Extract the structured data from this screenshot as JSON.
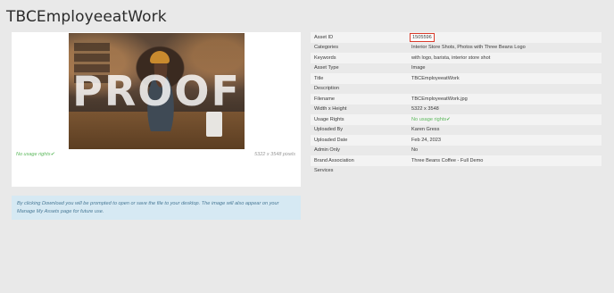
{
  "page": {
    "title": "TBCEmployeeatWork"
  },
  "preview": {
    "watermark": "PROOF",
    "usage_rights": "No usage rights✔",
    "dimensions": "5322 x 3548 pixels"
  },
  "notice": {
    "text": "By clicking Download you will be prompted to open or save the file to your desktop. The image will also appear on your Manage My Assets page for future use."
  },
  "details": [
    {
      "key": "Asset ID",
      "value": "1505596"
    },
    {
      "key": "Categories",
      "value": "Interior Store Shots, Photos with Three Beans Logo"
    },
    {
      "key": "Keywords",
      "value": "with logo, barista, interior store shot"
    },
    {
      "key": "Asset Type",
      "value": "Image"
    },
    {
      "key": "Title",
      "value": "TBCEmployeeatWork"
    },
    {
      "key": "Description",
      "value": ""
    },
    {
      "key": "Filename",
      "value": "TBCEmployeeatWork.jpg"
    },
    {
      "key": "Width x Height",
      "value": "5322 x 3548"
    },
    {
      "key": "Usage Rights",
      "value": "No usage rights✔"
    },
    {
      "key": "Uploaded By",
      "value": "Karen Gress"
    },
    {
      "key": "Uploaded Date",
      "value": "Feb 24, 2023"
    },
    {
      "key": "Admin Only",
      "value": "No"
    },
    {
      "key": "Brand Association",
      "value": "Three Beans Coffee - Full Demo"
    },
    {
      "key": "Services",
      "value": ""
    }
  ],
  "colors": {
    "highlight_border": "#d93b2b",
    "usage_green": "#5cb85c",
    "info_background": "#d6e9f3"
  }
}
